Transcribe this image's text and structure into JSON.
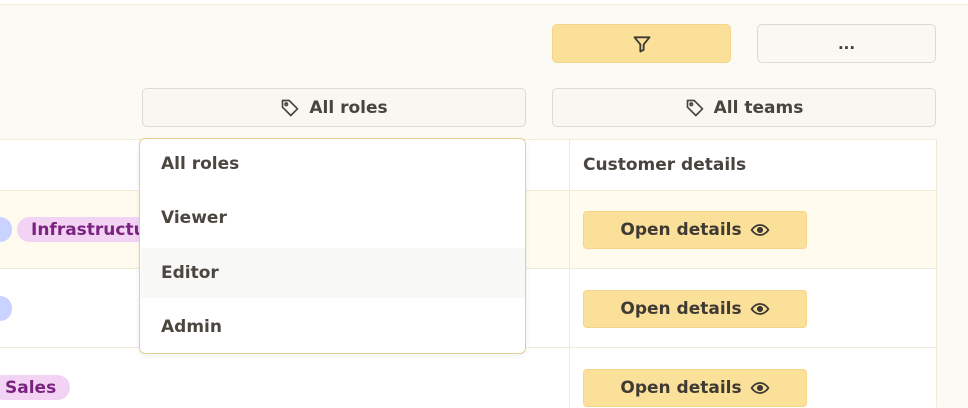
{
  "toolbar": {
    "filter_icon": "filter-icon",
    "more_label": "..."
  },
  "filters": {
    "roles_label": "All roles",
    "teams_label": "All teams",
    "tag_icon": "tag-icon"
  },
  "roles_dropdown": {
    "options": [
      "All roles",
      "Viewer",
      "Editor",
      "Admin"
    ],
    "highlighted_index": 2
  },
  "table": {
    "header": {
      "customer_details": "Customer details"
    },
    "rows": [
      {
        "tag": "Infrastructure",
        "action_label": "Open details"
      },
      {
        "tag": "",
        "action_label": "Open details"
      },
      {
        "tag": "Sales",
        "action_label": "Open details"
      }
    ]
  },
  "colors": {
    "accent": "#fbe09a",
    "tag_bg": "#f3d3f3",
    "tag_text": "#7b2380",
    "blue_chip": "#cad3ff",
    "highlight_row": "#fffbee"
  }
}
